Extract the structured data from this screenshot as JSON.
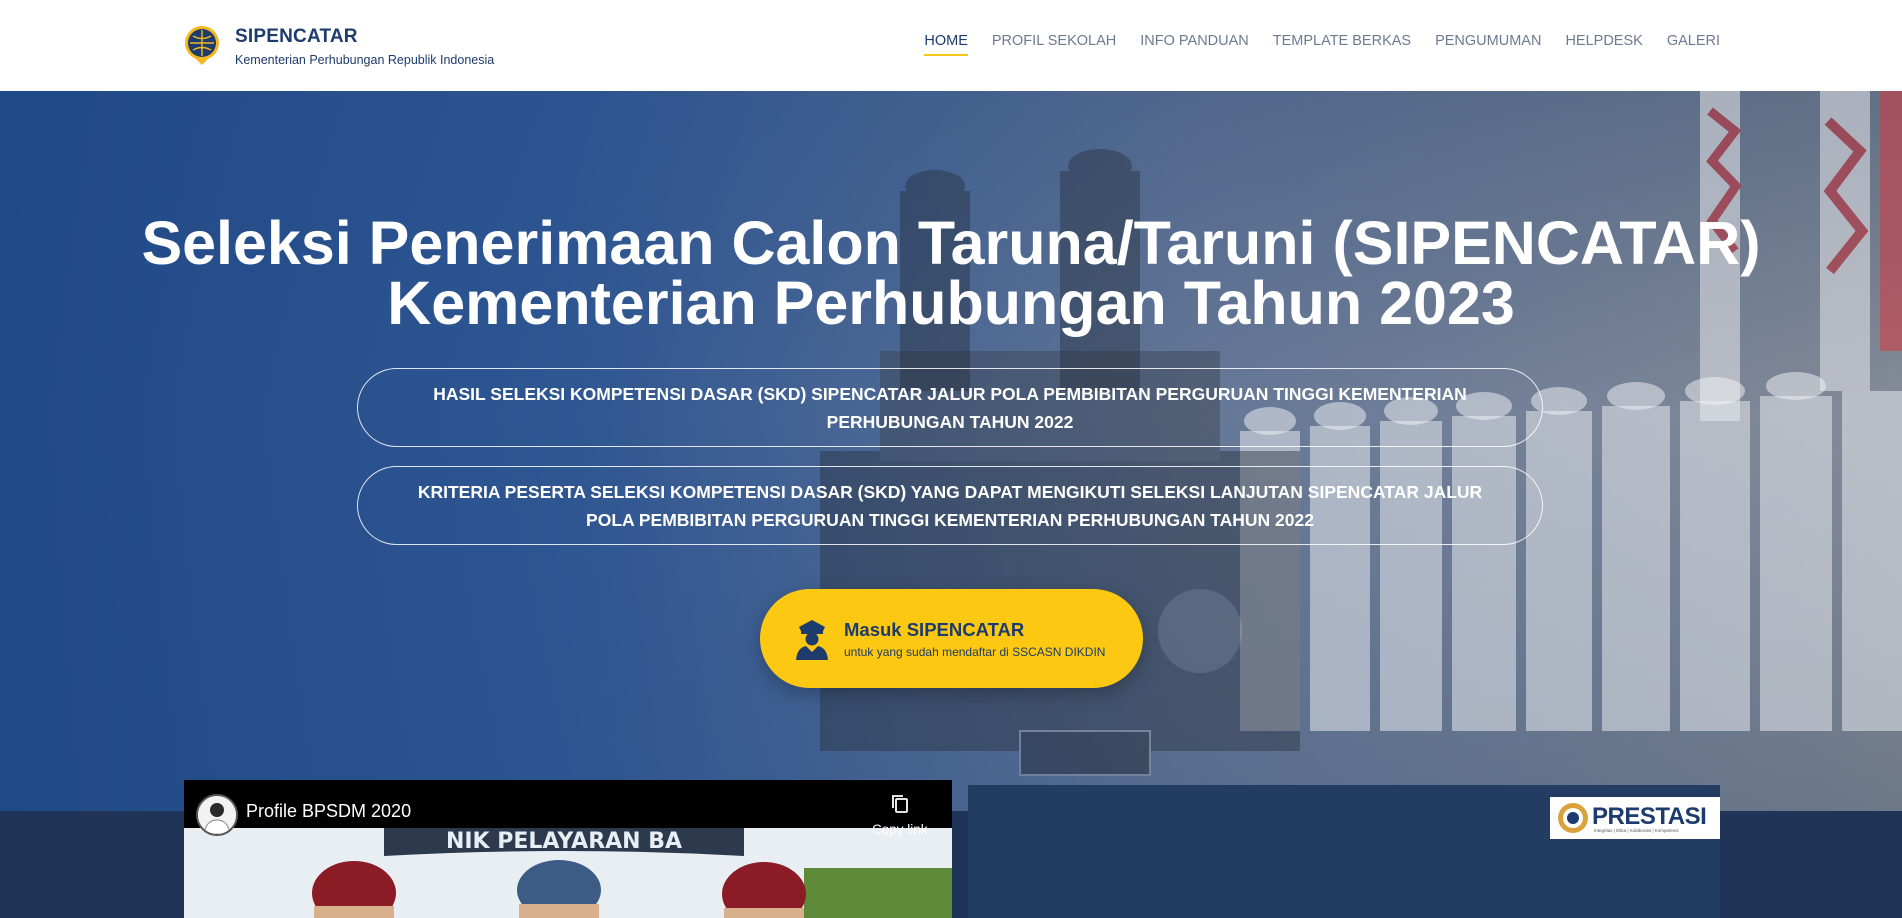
{
  "brand": {
    "name": "SIPENCATAR",
    "subtitle": "Kementerian Perhubungan Republik Indonesia"
  },
  "nav": {
    "items": [
      {
        "label": "HOME",
        "active": true
      },
      {
        "label": "PROFIL SEKOLAH",
        "active": false
      },
      {
        "label": "INFO PANDUAN",
        "active": false
      },
      {
        "label": "TEMPLATE BERKAS",
        "active": false
      },
      {
        "label": "PENGUMUMAN",
        "active": false
      },
      {
        "label": "HELPDESK",
        "active": false
      },
      {
        "label": "GALERI",
        "active": false
      }
    ]
  },
  "hero": {
    "title_line1": "Seleksi Penerimaan Calon Taruna/Taruni (SIPENCATAR)",
    "title_line2": "Kementerian Perhubungan Tahun 2023",
    "pill1": "HASIL SELEKSI KOMPETENSI DASAR (SKD) SIPENCATAR JALUR POLA PEMBIBITAN PERGURUAN TINGGI KEMENTERIAN PERHUBUNGAN TAHUN 2022",
    "pill2": "KRITERIA PESERTA SELEKSI KOMPETENSI DASAR (SKD) YANG DAPAT MENGIKUTI SELEKSI LANJUTAN SIPENCATAR JALUR POLA PEMBIBITAN PERGURUAN TINGGI KEMENTERIAN PERHUBUNGAN TAHUN 2022"
  },
  "cta": {
    "title": "Masuk SIPENCATAR",
    "subtitle": "untuk yang sudah mendaftar di SSCASN DIKDIN",
    "icon": "officer-icon"
  },
  "video": {
    "title": "Profile BPSDM 2020",
    "copy_label": "Copy link",
    "banner_text": "NIK PELAYARAN BA"
  },
  "badge": {
    "text": "PRESTASI",
    "tagline": "Integritas | Etika | Kolaborasi | Kompetensi"
  },
  "colors": {
    "brand_navy": "#1d3b6c",
    "accent_yellow": "#fcc812",
    "hero_blue": "#1e4887",
    "band": "#1f3456"
  }
}
